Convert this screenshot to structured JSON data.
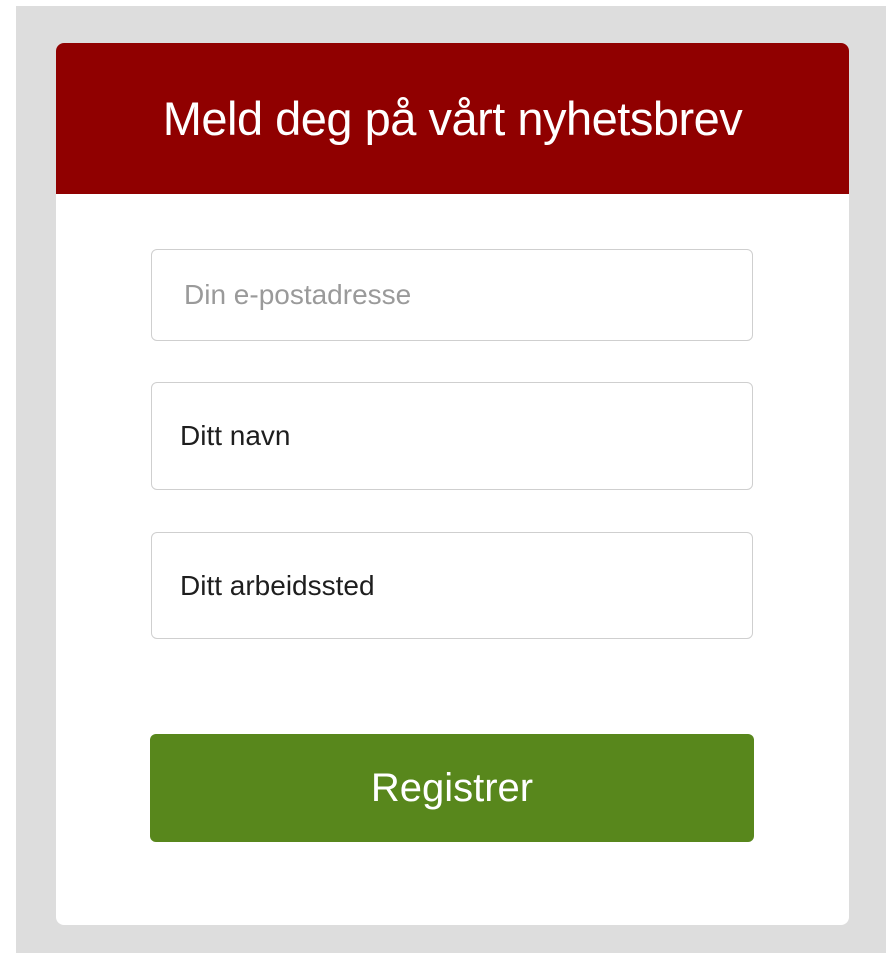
{
  "form": {
    "title": "Meld deg på vårt nyhetsbrev",
    "email_placeholder": "Din e-postadresse",
    "email_value": "",
    "name_placeholder": "Ditt navn",
    "name_value": "",
    "workplace_placeholder": "Ditt arbeidssted",
    "workplace_value": "",
    "submit_label": "Registrer"
  },
  "colors": {
    "header_background": "#900000",
    "submit_background": "#58871c",
    "page_background": "#dddddd"
  }
}
